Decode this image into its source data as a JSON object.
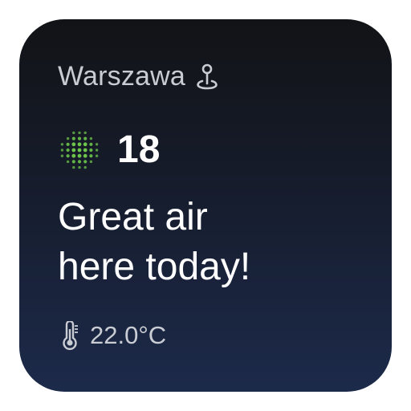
{
  "widget": {
    "location": "Warszawa",
    "location_icon": "location-pin-icon",
    "aqi": {
      "icon": "air-quality-dots-icon",
      "value": "18",
      "color": "#6cc44a"
    },
    "headline": {
      "line1": "Great air",
      "line2": "here today!"
    },
    "temperature": {
      "icon": "thermometer-icon",
      "value": "22.0°C"
    },
    "colors": {
      "background_top": "#121316",
      "background_bottom": "#1c2a4a",
      "primary_text": "#ffffff",
      "secondary_text": "#c9ccd3"
    }
  }
}
